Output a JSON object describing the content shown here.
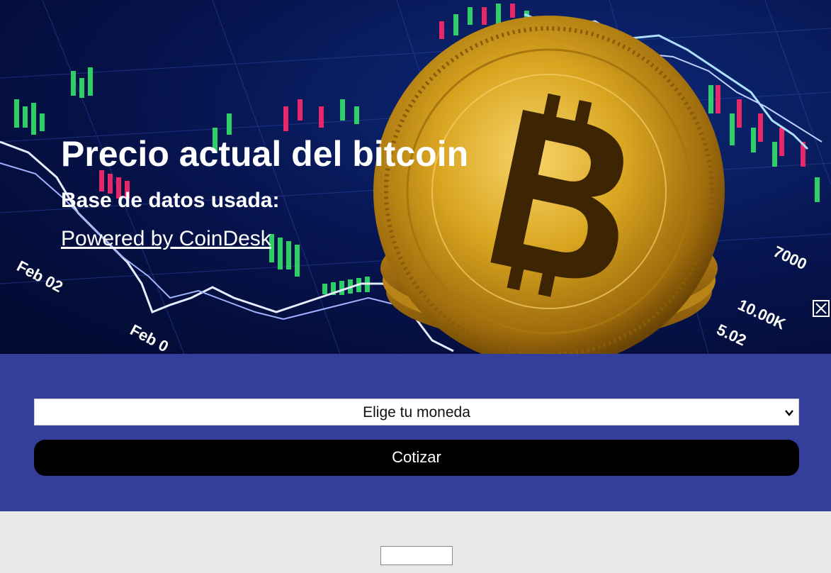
{
  "hero": {
    "title": "Precio actual del bitcoin",
    "subtitle": "Base de datos usada:",
    "link_text": "Powered by CoinDesk",
    "chart_tick_labels": [
      "Feb 02",
      "Feb 0",
      "7000",
      "10.00K",
      "5.02"
    ]
  },
  "form": {
    "select_value": "Elige tu moneda",
    "submit_label": "Cotizar"
  },
  "result": {
    "value": ""
  },
  "colors": {
    "panel": "#343e9b",
    "button": "#000000",
    "page_bg": "#e8e8e8",
    "hero_bg": "#06124a",
    "coin_gold": "#d9a520"
  },
  "icons": [
    "bitcoin-coin-image",
    "chevron-down-icon"
  ]
}
